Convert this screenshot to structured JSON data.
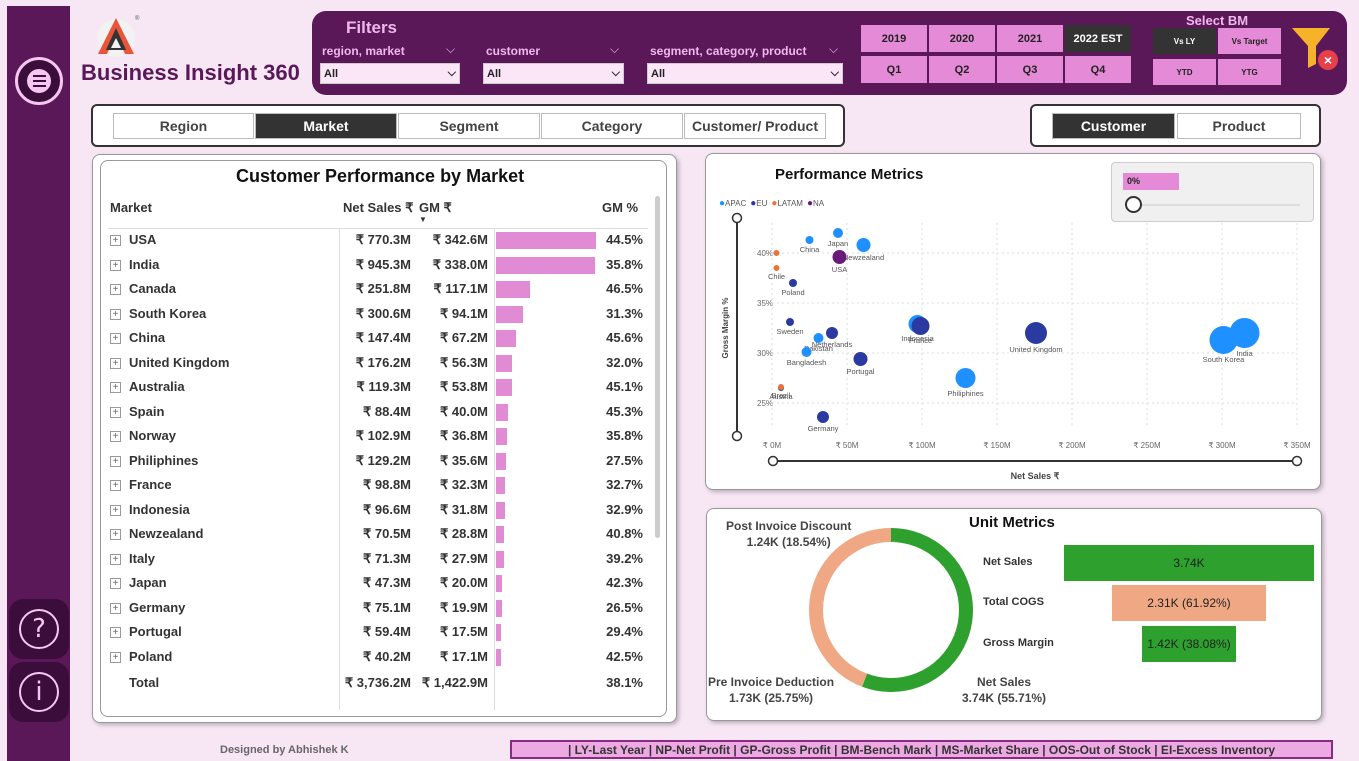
{
  "app": {
    "title": "Business Insight 360",
    "credit": "Designed by Abhishek K"
  },
  "filters": {
    "title": "Filters",
    "region": {
      "label": "region, market",
      "value": "All"
    },
    "customer": {
      "label": "customer",
      "value": "All"
    },
    "segment": {
      "label": "segment, category, product",
      "value": "All"
    }
  },
  "years": [
    "2019",
    "2020",
    "2021",
    "2022 EST"
  ],
  "quarters": [
    "Q1",
    "Q2",
    "Q3",
    "Q4"
  ],
  "benchmark": {
    "title": "Select BM",
    "options": [
      "Vs LY",
      "Vs Target",
      "YTD",
      "YTG"
    ]
  },
  "tabs": [
    "Region",
    "Market",
    "Segment",
    "Category",
    "Customer/ Product"
  ],
  "view_tabs": [
    "Customer",
    "Product"
  ],
  "table": {
    "title": "Customer Performance by Market",
    "headers": {
      "market": "Market",
      "net_sales": "Net Sales ₹",
      "gm": "GM ₹",
      "gm_pct": "GM %"
    },
    "rows": [
      {
        "market": "USA",
        "net_sales": "₹ 770.3M",
        "gm": "₹ 342.6M",
        "gm_value": 342.6,
        "gm_pct": "44.5%"
      },
      {
        "market": "India",
        "net_sales": "₹ 945.3M",
        "gm": "₹ 338.0M",
        "gm_value": 338.0,
        "gm_pct": "35.8%"
      },
      {
        "market": "Canada",
        "net_sales": "₹ 251.8M",
        "gm": "₹ 117.1M",
        "gm_value": 117.1,
        "gm_pct": "46.5%"
      },
      {
        "market": "South Korea",
        "net_sales": "₹ 300.6M",
        "gm": "₹ 94.1M",
        "gm_value": 94.1,
        "gm_pct": "31.3%"
      },
      {
        "market": "China",
        "net_sales": "₹ 147.4M",
        "gm": "₹ 67.2M",
        "gm_value": 67.2,
        "gm_pct": "45.6%"
      },
      {
        "market": "United Kingdom",
        "net_sales": "₹ 176.2M",
        "gm": "₹ 56.3M",
        "gm_value": 56.3,
        "gm_pct": "32.0%"
      },
      {
        "market": "Australia",
        "net_sales": "₹ 119.3M",
        "gm": "₹ 53.8M",
        "gm_value": 53.8,
        "gm_pct": "45.1%"
      },
      {
        "market": "Spain",
        "net_sales": "₹ 88.4M",
        "gm": "₹ 40.0M",
        "gm_value": 40.0,
        "gm_pct": "45.3%"
      },
      {
        "market": "Norway",
        "net_sales": "₹ 102.9M",
        "gm": "₹ 36.8M",
        "gm_value": 36.8,
        "gm_pct": "35.8%"
      },
      {
        "market": "Philiphines",
        "net_sales": "₹ 129.2M",
        "gm": "₹ 35.6M",
        "gm_value": 35.6,
        "gm_pct": "27.5%"
      },
      {
        "market": "France",
        "net_sales": "₹ 98.8M",
        "gm": "₹ 32.3M",
        "gm_value": 32.3,
        "gm_pct": "32.7%"
      },
      {
        "market": "Indonesia",
        "net_sales": "₹ 96.6M",
        "gm": "₹ 31.8M",
        "gm_value": 31.8,
        "gm_pct": "32.9%"
      },
      {
        "market": "Newzealand",
        "net_sales": "₹ 70.5M",
        "gm": "₹ 28.8M",
        "gm_value": 28.8,
        "gm_pct": "40.8%"
      },
      {
        "market": "Italy",
        "net_sales": "₹ 71.3M",
        "gm": "₹ 27.9M",
        "gm_value": 27.9,
        "gm_pct": "39.2%"
      },
      {
        "market": "Japan",
        "net_sales": "₹ 47.3M",
        "gm": "₹ 20.0M",
        "gm_value": 20.0,
        "gm_pct": "42.3%"
      },
      {
        "market": "Germany",
        "net_sales": "₹ 75.1M",
        "gm": "₹ 19.9M",
        "gm_value": 19.9,
        "gm_pct": "26.5%"
      },
      {
        "market": "Portugal",
        "net_sales": "₹ 59.4M",
        "gm": "₹ 17.5M",
        "gm_value": 17.5,
        "gm_pct": "29.4%"
      },
      {
        "market": "Poland",
        "net_sales": "₹ 40.2M",
        "gm": "₹ 17.1M",
        "gm_value": 17.1,
        "gm_pct": "42.5%"
      }
    ],
    "total": {
      "market": "Total",
      "net_sales": "₹ 3,736.2M",
      "gm": "₹ 1,422.9M",
      "gm_pct": "38.1%"
    }
  },
  "performance": {
    "title": "Performance Metrics",
    "slider_label": "0%",
    "legend": [
      {
        "name": "APAC",
        "color": "#1e90ff"
      },
      {
        "name": "EU",
        "color": "#2a3aa0"
      },
      {
        "name": "LATAM",
        "color": "#e8743b"
      },
      {
        "name": "NA",
        "color": "#6a1b7a"
      }
    ]
  },
  "chart_data": [
    {
      "type": "scatter",
      "title": "Performance Metrics",
      "xlabel": "Net Sales ₹",
      "ylabel": "Gross Margin %",
      "xlim": [
        0,
        350
      ],
      "ylim": [
        23,
        42
      ],
      "x_ticks": [
        "₹ 0M",
        "₹ 50M",
        "₹ 100M",
        "₹ 150M",
        "₹ 200M",
        "₹ 250M",
        "₹ 300M",
        "₹ 350M"
      ],
      "y_ticks": [
        "25%",
        "30%",
        "35%",
        "40%"
      ],
      "series": [
        {
          "name": "APAC",
          "color": "#1e90ff",
          "points": [
            {
              "label": "China",
              "x": 25,
              "y": 41.3,
              "r": 4
            },
            {
              "label": "Japan",
              "x": 44,
              "y": 42.0,
              "r": 5
            },
            {
              "label": "Newzealand",
              "x": 61,
              "y": 40.8,
              "r": 7
            },
            {
              "label": "Pakistan",
              "x": 31,
              "y": 31.5,
              "r": 5
            },
            {
              "label": "Bangladesh",
              "x": 23,
              "y": 30.1,
              "r": 5
            },
            {
              "label": "Indonesia",
              "x": 97,
              "y": 32.9,
              "r": 9
            },
            {
              "label": "Philiphines",
              "x": 129,
              "y": 27.5,
              "r": 10
            },
            {
              "label": "South Korea",
              "x": 301,
              "y": 31.3,
              "r": 14
            },
            {
              "label": "India",
              "x": 315,
              "y": 32.0,
              "r": 15
            }
          ]
        },
        {
          "name": "EU",
          "color": "#2a3aa0",
          "points": [
            {
              "label": "Poland",
              "x": 14,
              "y": 37.0,
              "r": 4
            },
            {
              "label": "Sweden",
              "x": 12,
              "y": 33.1,
              "r": 4
            },
            {
              "label": "Netherlands",
              "x": 40,
              "y": 32.0,
              "r": 6
            },
            {
              "label": "France",
              "x": 99,
              "y": 32.7,
              "r": 9
            },
            {
              "label": "Portugal",
              "x": 59,
              "y": 29.4,
              "r": 7
            },
            {
              "label": "United Kingdom",
              "x": 176,
              "y": 32.0,
              "r": 11
            },
            {
              "label": "Germany",
              "x": 34,
              "y": 23.6,
              "r": 6
            },
            {
              "label": "Austria",
              "x": 6,
              "y": 26.5,
              "r": 3
            }
          ]
        },
        {
          "name": "LATAM",
          "color": "#e8743b",
          "points": [
            {
              "label": "Chile",
              "x": 3,
              "y": 38.5,
              "r": 3
            },
            {
              "label": "",
              "x": 3,
              "y": 40.0,
              "r": 3
            },
            {
              "label": "Brazil",
              "x": 6,
              "y": 26.6,
              "r": 3
            }
          ]
        },
        {
          "name": "NA",
          "color": "#6a1b7a",
          "points": [
            {
              "label": "USA",
              "x": 45,
              "y": 39.6,
              "r": 7
            }
          ]
        }
      ]
    },
    {
      "type": "pie",
      "title": "Unit Metrics",
      "slices": [
        {
          "label": "Net Sales",
          "value_text": "3.74K (55.71%)",
          "pct": 55.71,
          "color": "#2ea02e"
        },
        {
          "label": "Pre Invoice Deduction",
          "value_text": "1.73K (25.75%)",
          "pct": 25.75,
          "color": "#f0a884"
        },
        {
          "label": "Post Invoice Discount",
          "value_text": "1.24K (18.54%)",
          "pct": 18.54,
          "color": "#f0a884"
        }
      ]
    },
    {
      "type": "bar",
      "title": "Unit Metrics",
      "categories": [
        "Net Sales",
        "Total COGS",
        "Gross Margin"
      ],
      "values": [
        3.74,
        2.31,
        1.42
      ],
      "value_labels": [
        "3.74K",
        "2.31K (61.92%)",
        "1.42K (38.08%)"
      ],
      "colors": [
        "#2ea02e",
        "#f0a884",
        "#2ea02e"
      ]
    }
  ],
  "footer": {
    "legend": "| LY-Last Year | NP-Net Profit | GP-Gross Profit | BM-Bench Mark | MS-Market Share | OOS-Out of Stock | EI-Excess Inventory"
  }
}
